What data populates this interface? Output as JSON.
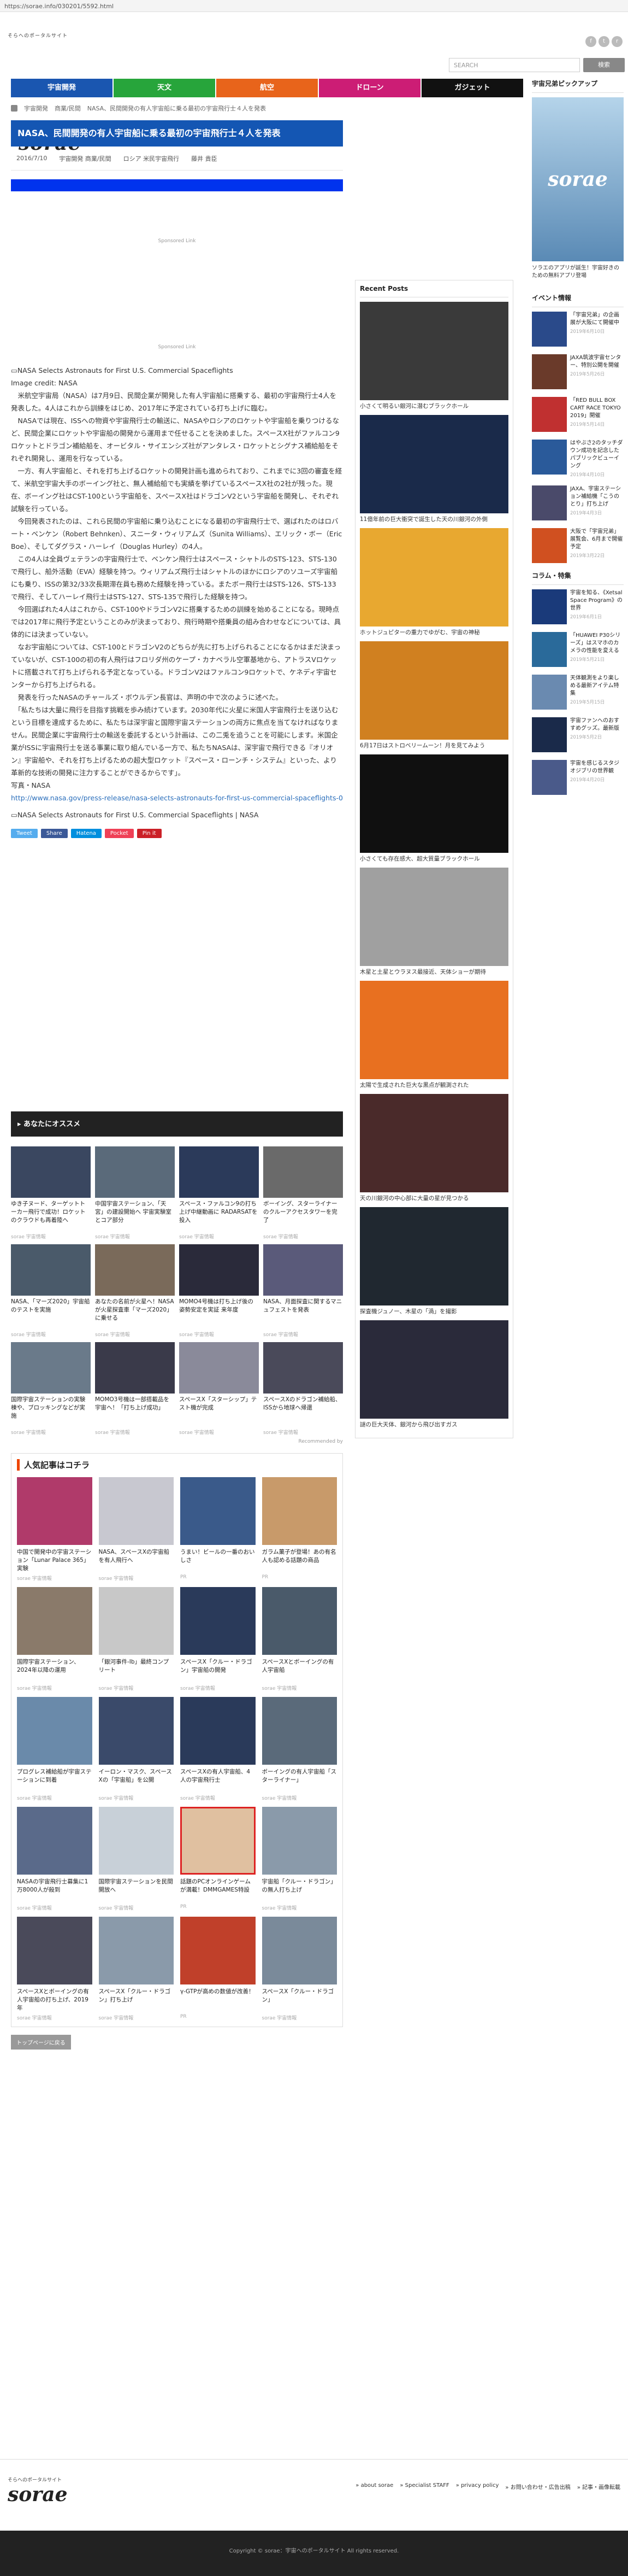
{
  "browser": {
    "url": "https://sorae.info/030201/5592.html"
  },
  "site": {
    "tagline": "そらへのポータルサイト",
    "name": "sorae",
    "search_placeholder": "SEARCH",
    "search_button": "検索"
  },
  "nav": [
    {
      "label": "宇宙開発",
      "color": "#1a56b0"
    },
    {
      "label": "天文",
      "color": "#27a53b"
    },
    {
      "label": "航空",
      "color": "#e8641b"
    },
    {
      "label": "ドローン",
      "color": "#cc1d75"
    },
    {
      "label": "ガジェット",
      "color": "#111111"
    }
  ],
  "breadcrumb": [
    "宇宙開発",
    "商業/民間",
    "NASA、民間開発の有人宇宙船に乗る最初の宇宙飛行士４人を発表"
  ],
  "article": {
    "title": "NASA、民間開発の有人宇宙船に乗る最初の宇宙飛行士４人を発表",
    "date": "2016/7/10",
    "category": "宇宙開発 商業/民間",
    "tags": "ロシア 米民宇宙飛行",
    "author": "藤井 貴臣",
    "sponsored": "Sponsored Link",
    "image_alt": "NASA Selects Astronauts for First U.S. Commercial Spaceflights",
    "image_credit": "Image credit: NASA",
    "paragraphs": [
      "米航空宇宙局（NASA）は7月9日、民間企業が開発した有人宇宙船に搭乗する、最初の宇宙飛行士4人を発表した。4人はこれから訓練をはじめ、2017年に予定されている打ち上げに臨む。",
      "NASAでは現在、ISSへの物資や宇宙飛行士の輸送に、NASAやロシアのロケットや宇宙船を乗りつけるなど、民間企業にロケットや宇宙船の開発から運用まで任せることを決めました。スペースX社がファルコン9ロケットとドラゴン補給船を、オービタル・サイエンシズ社がアンタレス・ロケットとシグナス補給船をそれぞれ開発し、運用を行なっている。",
      "一方、有人宇宙船と、それを打ち上げるロケットの開発計画も進められており、これまでに3回の審査を経て、米航空宇宙大手のボーイング社と、無人補給船でも実績を挙げているスペースX社の2社が残った。現在、ボーイング社はCST-100という宇宙船を、スペースX社はドラゴンV2という宇宙船を開発し、それぞれ試験を行っている。",
      "今回発表されたのは、これら民間の宇宙船に乗り込むことになる最初の宇宙飛行士で、選ばれたのはロバート・ベンケン（Robert Behnken）、スニータ・ウィリアムズ（Sunita Williams）、エリック・ボー（Eric Boe）、そしてダグラス・ハーレイ（Douglas Hurley）の4人。",
      "この4人は全員ヴェテランの宇宙飛行士で、ベンケン飛行士はスペース・シャトルのSTS-123、STS-130で飛行し、船外活動（EVA）経験を持つ。ウィリアムズ飛行士はシャトルのほかにロシアのソユーズ宇宙船にも乗り、ISSの第32/33次長期滞在員も務めた経験を持っている。またボー飛行士はSTS-126、STS-133で飛行、そしてハーレイ飛行士はSTS-127、STS-135で飛行した経験を持つ。",
      "今回選ばれた4人はこれから、CST-100やドラゴンV2に搭乗するための訓練を始めることになる。現時点では2017年に飛行予定ということのみが決まっており、飛行時期や搭乗員の組み合わせなどについては、具体的には決まっていない。",
      "なお宇宙船については、CST-100とドラゴンV2のどちらが先に打ち上げられることになるかはまだ決まっていないが、CST-100の初の有人飛行はフロリダ州のケープ・カナベラル空軍基地から、アトラスVロケットに搭載されて打ち上げられる予定となっている。ドラゴンV2はファルコン9ロケットで、ケネディ宇宙センターから打ち上げられる。",
      "発表を行ったNASAのチャールズ・ボウルデン長官は、声明の中で次のように述べた。",
      "「私たちは大量に飛行を目指す挑戦を歩み続けています。2030年代に火星に米国人宇宙飛行士を送り込むという目標を達成するために、私たちは深宇宙と国際宇宙ステーションの両方に焦点を当てなければなりません。民間企業に宇宙飛行士の輸送を委託するという計画は、この二兎を追うことを可能にします。米国企業がISSに宇宙飛行士を送る事業に取り組んでいる一方で、私たちNASAは、深宇宙で飛行できる『オリオン』宇宙船や、それを打ち上げるための超大型ロケット『スペース・ローンチ・システム』といった、より革新的な技術の開発に注力することができるからです」。"
    ],
    "source_label": "写真・NASA",
    "source_link": "http://www.nasa.gov/press-release/nasa-selects-astronauts-for-first-us-commercial-spaceflights-0",
    "image2_alt": "NASA Selects Astronauts for First U.S. Commercial Spaceflights | NASA"
  },
  "share": [
    {
      "label": "Tweet",
      "color": "#55acee"
    },
    {
      "label": "Share",
      "color": "#3b5998"
    },
    {
      "label": "Hatena",
      "color": "#008fde"
    },
    {
      "label": "Pocket",
      "color": "#ef4056"
    },
    {
      "label": "Pin it",
      "color": "#cb2027"
    }
  ],
  "recommend": {
    "title": "あなたにオススメ",
    "items": [
      {
        "cap": "ゆき子ヌード、ターゲットトーカー飛行で成功！ロケットのクラウドも再着陸へ",
        "src": "sorae 宇宙情報"
      },
      {
        "cap": "中国宇宙ステーション、「天宮」の建設開始へ 宇宙実験室とコア部分",
        "src": "sorae 宇宙情報"
      },
      {
        "cap": "スペース・ファルコン9の打ち上げ中継動画に RADARSATを投入",
        "src": "sorae 宇宙情報"
      },
      {
        "cap": "ボーイング、スターライナーのクルーアクセスタワーを完了",
        "src": "sorae 宇宙情報"
      },
      {
        "cap": "NASA、「マーズ2020」宇宙船のテストを実施",
        "src": "sorae 宇宙情報"
      },
      {
        "cap": "あなたの名前が火星へ！NASAが火星探査車「マーズ2020」に乗せる",
        "src": "sorae 宇宙情報"
      },
      {
        "cap": "MOMO4号機は打ち上げ後の姿勢安定を実証 来年度",
        "src": "sorae 宇宙情報"
      },
      {
        "cap": "NASA、月面探査に関するマニュフェストを発表",
        "src": "sorae 宇宙情報"
      },
      {
        "cap": "国際宇宙ステーションの実験棟や、ブロッキングなどが実施",
        "src": "sorae 宇宙情報"
      },
      {
        "cap": "MOMO3号機は一部搭載品を宇宙へ！「打ち上げ成功」",
        "src": "sorae 宇宙情報"
      },
      {
        "cap": "スペースX「スターシップ」テスト機が完成",
        "src": "sorae 宇宙情報"
      },
      {
        "cap": "スペースXのドラゴン補給船、ISSから地球へ帰還",
        "src": "sorae 宇宙情報"
      }
    ],
    "footer": "Recommended by"
  },
  "popular": {
    "title": "人気記事はコチラ",
    "items": [
      {
        "cap": "中国で開発中の宇宙ステーション「Lunar Palace 365」実験",
        "src": "sorae 宇宙情報"
      },
      {
        "cap": "NASA、スペースXの宇宙船を有人飛行へ",
        "src": "sorae 宇宙情報"
      },
      {
        "cap": "うまい！ビールの一番のおいしさ",
        "src": "PR"
      },
      {
        "cap": "ガラム菓子が登場！あの有名人も認める話題の商品",
        "src": "PR"
      },
      {
        "cap": "国際宇宙ステーション、2024年以降の運用",
        "src": "sorae 宇宙情報"
      },
      {
        "cap": "「銀河事件-Ib」最終コンプリート",
        "src": "sorae 宇宙情報"
      },
      {
        "cap": "スペースX「クルー・ドラゴン」宇宙船の開発",
        "src": "sorae 宇宙情報"
      },
      {
        "cap": "スペースXとボーイングの有人宇宙船",
        "src": "sorae 宇宙情報"
      },
      {
        "cap": "プログレス補給船が宇宙ステーションに到着",
        "src": "sorae 宇宙情報"
      },
      {
        "cap": "イーロン・マスク、スペースXの「宇宙船」を公開",
        "src": "sorae 宇宙情報"
      },
      {
        "cap": "スペースXの有人宇宙船、4人の宇宙飛行士",
        "src": "sorae 宇宙情報"
      },
      {
        "cap": "ボーイングの有人宇宙船「スターライナー」",
        "src": "sorae 宇宙情報"
      },
      {
        "cap": "NASAの宇宙飛行士募集に1万8000人が殺到",
        "src": "sorae 宇宙情報"
      },
      {
        "cap": "国際宇宙ステーションを民間開放へ",
        "src": "sorae 宇宙情報"
      },
      {
        "cap": "話題のPCオンラインゲームが満載！DMMGAMES特設",
        "src": "PR"
      },
      {
        "cap": "宇宙船「クルー・ドラゴン」の無人打ち上げ",
        "src": "sorae 宇宙情報"
      },
      {
        "cap": "スペースXとボーイングの有人宇宙船の打ち上げ、2019年",
        "src": "sorae 宇宙情報"
      },
      {
        "cap": "スペースX「クルー・ドラゴン」打ち上げ",
        "src": "sorae 宇宙情報"
      },
      {
        "cap": "γ-GTPが高めの数値が改善！",
        "src": "PR"
      },
      {
        "cap": "スペースX「クルー・ドラゴン」",
        "src": "sorae 宇宙情報"
      }
    ]
  },
  "top_button": "トップページに戻る",
  "recent": {
    "title": "Recent Posts",
    "items": [
      {
        "cap": "小さくて明るい銀河に潜むブラックホール"
      },
      {
        "cap": "11億年前の巨大衝突で誕生した天の川銀河の外側"
      },
      {
        "cap": "ホットジュピターの重力でゆがむ、宇宙の神秘"
      },
      {
        "cap": "6月17日はストロベリームーン！月を見てみよう"
      },
      {
        "cap": "小さくても存在感大、超大質量ブラックホール"
      },
      {
        "cap": "木星と土星とウラヌス最接近、天体ショーが期待"
      },
      {
        "cap": "太陽で生成された巨大な黒点が観測された"
      },
      {
        "cap": "天の川銀河の中心部に大量の星が見つかる"
      },
      {
        "cap": "探査機ジュノー、木星の「渦」を撮影"
      },
      {
        "cap": "謎の巨大天体、銀河から飛び出すガス"
      }
    ]
  },
  "sidebar": {
    "app_title": "宇宙兄弟ピックアップ",
    "app_caption": "ソラエのアプリが誕生！宇宙好きのための無料アプリ登場",
    "events_title": "イベント情報",
    "events": [
      {
        "cap": "「宇宙兄弟」の企画展が大阪にて開催中",
        "date": "2019年6月10日"
      },
      {
        "cap": "JAXA筑波宇宙センター、特別公開を開催",
        "date": "2019年5月26日"
      },
      {
        "cap": "「RED BULL BOX CART RACE TOKYO 2019」開催",
        "date": "2019年5月14日"
      },
      {
        "cap": "はやぶさ2のタッチダウン成功を記念したパブリックビューイング",
        "date": "2019年4月10日"
      },
      {
        "cap": "JAXA、宇宙ステーション補給機「こうのとり」打ち上げ",
        "date": "2019年4月3日"
      },
      {
        "cap": "大阪で「宇宙兄弟」展覧会、6月まで開催予定",
        "date": "2019年3月22日"
      }
    ],
    "column_title": "コラム・特集",
    "columns": [
      {
        "cap": "宇宙を知る、《Xetsal Space Program》の世界",
        "date": "2019年6月1日"
      },
      {
        "cap": "「HUAWEI P30シリーズ」はスマホのカメラの性能を変える",
        "date": "2019年5月21日"
      },
      {
        "cap": "天体観測をより楽しめる最新アイテム特集",
        "date": "2019年5月15日"
      },
      {
        "cap": "宇宙ファンへのおすすめグッズ。最新版",
        "date": "2019年5月2日"
      },
      {
        "cap": "宇宙を感じるスタジオジブリの世界観",
        "date": "2019年4月20日"
      }
    ]
  },
  "footer": {
    "links": [
      "about sorae",
      "Specialist STAFF",
      "privacy policy",
      "お問い合わせ・広告出稿",
      "記事・画像転載"
    ],
    "copyright": "Copyright © sorae：宇宙へのポータルサイト All rights reserved."
  }
}
